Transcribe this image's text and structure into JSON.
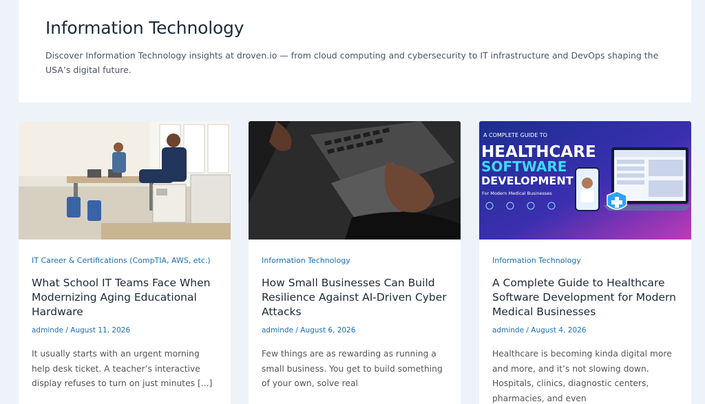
{
  "header": {
    "title": "Information Technology",
    "description": "Discover Information Technology insights at droven.io — from cloud computing and cybersecurity to IT infrastructure and DevOps shaping the USA’s digital future."
  },
  "posts": [
    {
      "category": "IT Career & Certifications (CompTIA, AWS, etc.)",
      "title": "What School IT Teams Face When Modernizing Aging Educational Hardware",
      "author": "adminde",
      "date": "August 11, 2026",
      "excerpt": "It usually starts with an urgent morning help desk ticket. A teacher’s interactive display refuses to turn on just minutes [...]"
    },
    {
      "category": "Information Technology",
      "title": "How Small Businesses Can Build Resilience Against AI-Driven Cyber Attacks",
      "author": "adminde",
      "date": "August 6, 2026",
      "excerpt": "Few things are as rewarding as running a small business. You get to build something of your own, solve real"
    },
    {
      "category": "Information Technology",
      "title": "A Complete Guide to Healthcare Software Development for Modern Medical Businesses",
      "author": "adminde",
      "date": "August 4, 2026",
      "excerpt": "Healthcare is becoming kinda digital more and more, and it’s not slowing down. Hospitals, clinics, diagnostic centers, pharmacies, and even"
    }
  ],
  "graphic": {
    "top": "A COMPLETE GUIDE TO",
    "line1": "HEALTHCARE",
    "line2": "SOFTWARE",
    "line3": "DEVELOPMENT",
    "sub": "For Modern Medical Businesses"
  },
  "colors": {
    "accent": "#1a6fb6",
    "background": "#eef3fa"
  }
}
